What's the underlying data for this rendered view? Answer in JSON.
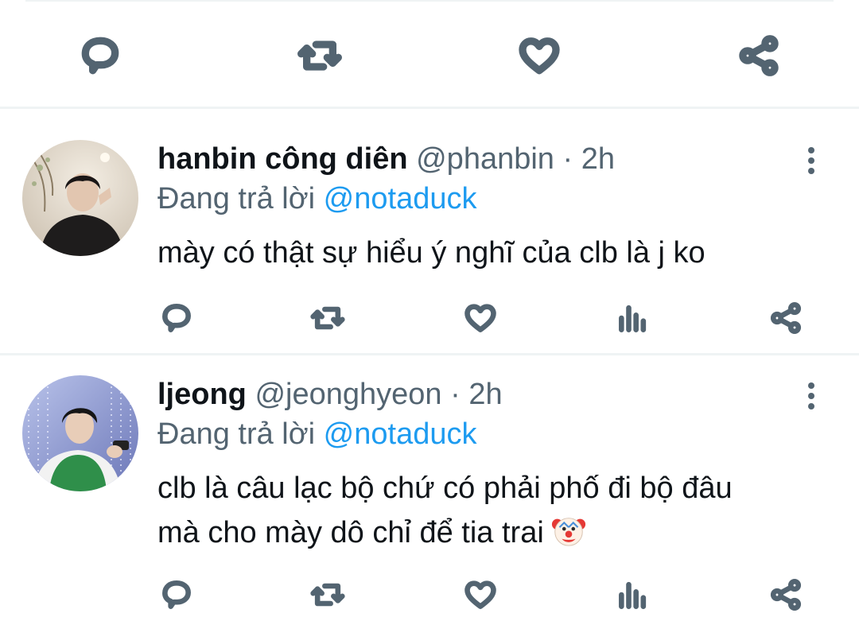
{
  "top_actions": {
    "icons": [
      "reply-icon",
      "retweet-icon",
      "like-icon",
      "share-icon"
    ]
  },
  "tweets": [
    {
      "display_name": "hanbin công diên",
      "handle": "@phanbin",
      "separator": "·",
      "time": "2h",
      "reply_prefix": "Đang trả lời",
      "reply_to": "@notaduck",
      "text_lines": [
        "mày có thật sự hiểu ý nghĩ của clb là j ko"
      ]
    },
    {
      "display_name": "ljeong",
      "handle": "@jeonghyeon",
      "separator": "·",
      "time": "2h",
      "reply_prefix": "Đang trả lời",
      "reply_to": "@notaduck",
      "text_lines": [
        "clb là câu lạc bộ chứ có phải phố đi bộ đâu",
        "mà cho mày dô chỉ để tia trai"
      ],
      "emoji": "clown-face"
    }
  ],
  "colors": {
    "text": "#0f1419",
    "secondary": "#536471",
    "accent": "#1d9bf0",
    "divider": "#eff3f4"
  }
}
